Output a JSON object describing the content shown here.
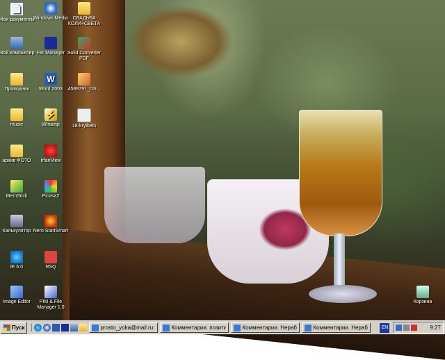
{
  "desktop": {
    "icons": [
      {
        "label": "Мои документы",
        "icon": "my-documents-icon"
      },
      {
        "label": "Мой компьютер",
        "icon": "my-computer-icon"
      },
      {
        "label": "Проводник",
        "icon": "explorer-icon"
      },
      {
        "label": "music",
        "icon": "folder-icon"
      },
      {
        "label": "архив ФОТО",
        "icon": "folder-icon"
      },
      {
        "label": "MemStick",
        "icon": "memstick-icon"
      },
      {
        "label": "Калькулятор",
        "icon": "calculator-icon"
      },
      {
        "label": "IE 6.0",
        "icon": "internet-explorer-icon"
      },
      {
        "label": "Image Editor",
        "icon": "image-editor-icon"
      },
      {
        "label": "Windows Media",
        "icon": "windows-media-icon"
      },
      {
        "label": "Far Manager",
        "icon": "far-manager-icon"
      },
      {
        "label": "Word 2003",
        "icon": "word-icon"
      },
      {
        "label": "Winamp",
        "icon": "winamp-icon"
      },
      {
        "label": "IrfanView",
        "icon": "irfanview-icon"
      },
      {
        "label": "Picasa2",
        "icon": "picasa-icon"
      },
      {
        "label": "Nero StartSmart",
        "icon": "nero-icon"
      },
      {
        "label": "RSQ",
        "icon": "rsq-icon"
      },
      {
        "label": "PIM & File Manager 1.0",
        "icon": "pim-icon"
      },
      {
        "label": "СВАДЬБА КОЛИ+СВЕТА",
        "icon": "folder-icon"
      },
      {
        "label": "Solid Converter PDF",
        "icon": "pdf-converter-icon"
      },
      {
        "label": "4589791_DS...",
        "icon": "image-file-icon"
      },
      {
        "label": "18-krylbeln",
        "icon": "file-icon"
      },
      {
        "label": "Корзина",
        "icon": "recycle-bin-icon"
      }
    ]
  },
  "taskbar": {
    "start_label": "Пуск",
    "tasks": [
      {
        "label": "prosto_yoka@mail.ru: В..."
      },
      {
        "label": "Комментарии. позитив..."
      },
      {
        "label": "Комментарии. Нерабоч..."
      },
      {
        "label": "Комментарии. Нерабоч..."
      }
    ],
    "language": "EN",
    "clock": "9:27"
  }
}
